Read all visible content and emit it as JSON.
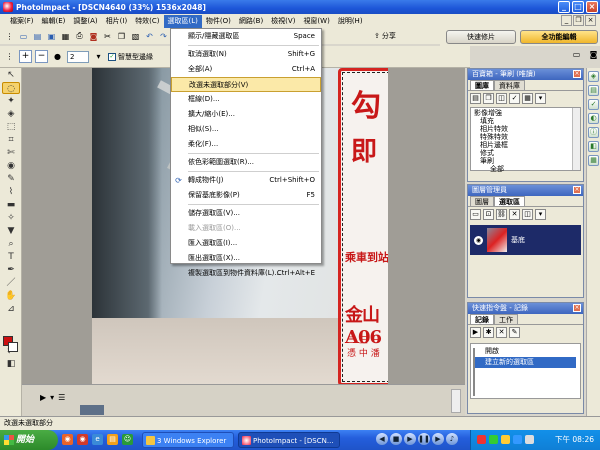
{
  "window": {
    "title": "PhotoImpact - [DSCN4640 (33%) 1536x2048]"
  },
  "menubar": {
    "items": [
      "檔案(F)",
      "編輯(E)",
      "調整(A)",
      "相片(I)",
      "特效(C)",
      "選取區(L)",
      "物件(O)",
      "網路(B)",
      "檢視(V)",
      "視窗(W)",
      "說明(H)"
    ]
  },
  "toolbar": {
    "share_label": "分享"
  },
  "mode_tabs": {
    "quick": "快速修片",
    "full": "全功能編輯"
  },
  "options_bar": {
    "size_value": "2",
    "smart_edge_label": "智慧型邊緣"
  },
  "selection_menu": {
    "items": [
      {
        "label": "顯示/隱藏選取區",
        "shortcut": "Space"
      },
      {
        "label": "取消選取(N)",
        "shortcut": "Shift+G"
      },
      {
        "label": "全部(A)",
        "shortcut": "Ctrl+A"
      },
      {
        "label": "改選未選取部分(V)",
        "shortcut": ""
      },
      {
        "label": "框線(D)...",
        "shortcut": ""
      },
      {
        "label": "擴大/縮小(E)...",
        "shortcut": ""
      },
      {
        "label": "相似(S)...",
        "shortcut": ""
      },
      {
        "label": "柔化(F)...",
        "shortcut": ""
      },
      {
        "label": "依色彩範圍選取(R)...",
        "shortcut": ""
      },
      {
        "label": "轉成物件(J)",
        "shortcut": "Ctrl+Shift+O"
      },
      {
        "label": "保留基底影像(P)",
        "shortcut": "F5"
      },
      {
        "label": "儲存選取區(V)...",
        "shortcut": ""
      },
      {
        "label": "載入選取區(O)...",
        "shortcut": ""
      },
      {
        "label": "匯入選取區(I)...",
        "shortcut": ""
      },
      {
        "label": "匯出選取區(X)...",
        "shortcut": ""
      },
      {
        "label": "複製選取區到物件資料庫(L)...",
        "shortcut": "Ctrl+Alt+E"
      }
    ]
  },
  "photo": {
    "kanji_top": "勾",
    "kanji_mid": "即",
    "route_text": "乘車到站憑證",
    "district": "金山",
    "code": "A06",
    "line2": "二 三 一",
    "line3": "憑 中 潘"
  },
  "panel_gallery": {
    "title": "百寶箱 - 筆刷 (唯讀)",
    "tabs": [
      "圖庫",
      "資料庫"
    ],
    "tree": [
      "影像增強",
      "填充",
      "相片特效",
      "特殊特效",
      "相片邊框",
      "修式",
      "筆刷",
      "全部"
    ]
  },
  "panel_layers": {
    "title": "圖層管理員",
    "tabs": [
      "圖層",
      "選取區"
    ],
    "item_label": "基底"
  },
  "panel_commands": {
    "title": "快速指令盤 - 記錄",
    "tabs": [
      "記錄",
      "工作"
    ],
    "items": [
      "開啟",
      "建立新的選取區"
    ]
  },
  "statusbar": {
    "text": "改選未選取部分"
  },
  "taskbar": {
    "start": "開始",
    "tasks": [
      "3 Windows Explorer",
      "PhotoImpact - [DSCN..."
    ],
    "clock": "下午 08:26"
  }
}
